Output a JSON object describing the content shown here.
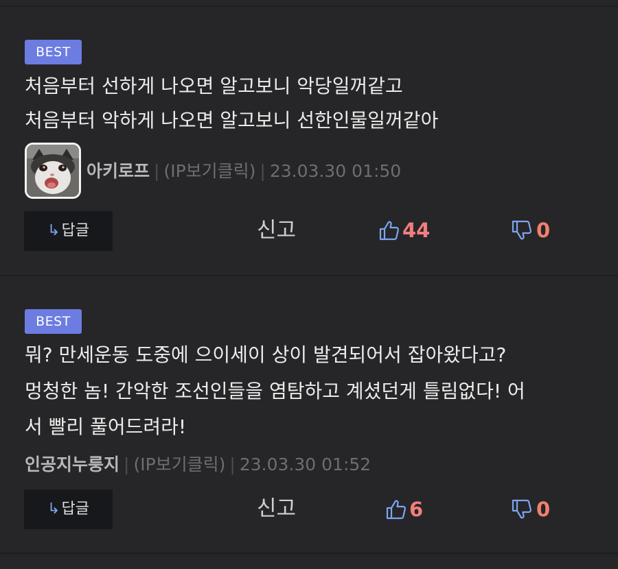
{
  "comments": [
    {
      "badge": "BEST",
      "lines": [
        "처음부터 선하게 나오면 알고보니 악당일꺼같고",
        "처음부터 악하게 나오면 알고보니 선한인물일꺼같아"
      ],
      "has_avatar": true,
      "avatar_icon": "cat-avatar",
      "nickname": "아키로프",
      "ip_label": "(IP보기클릭)",
      "timestamp": "23.03.30 01:50",
      "reply_arrow": "↳",
      "reply_label": "답글",
      "report_label": "신고",
      "likes": "44",
      "dislikes": "0"
    },
    {
      "badge": "BEST",
      "lines": [
        "뭐? 만세운동 도중에 으이세이 상이 발견되어서 잡아왔다고?",
        "멍청한 놈! 간악한 조선인들을 염탐하고 계셨던게 틀림없다! 어",
        "서 빨리 풀어드려라!"
      ],
      "has_avatar": false,
      "nickname": "인공지누룽지",
      "ip_label": "(IP보기클릭)",
      "timestamp": "23.03.30 01:52",
      "reply_arrow": "↳",
      "reply_label": "답글",
      "report_label": "신고",
      "likes": "6",
      "dislikes": "0"
    }
  ],
  "colors": {
    "background": "#262628",
    "badge": "#6c7ce0",
    "like_count": "#f17e7e",
    "dislike_count": "#f1806f",
    "thumb_icon": "#7ea5f2",
    "reply_button_bg": "#17181b"
  }
}
